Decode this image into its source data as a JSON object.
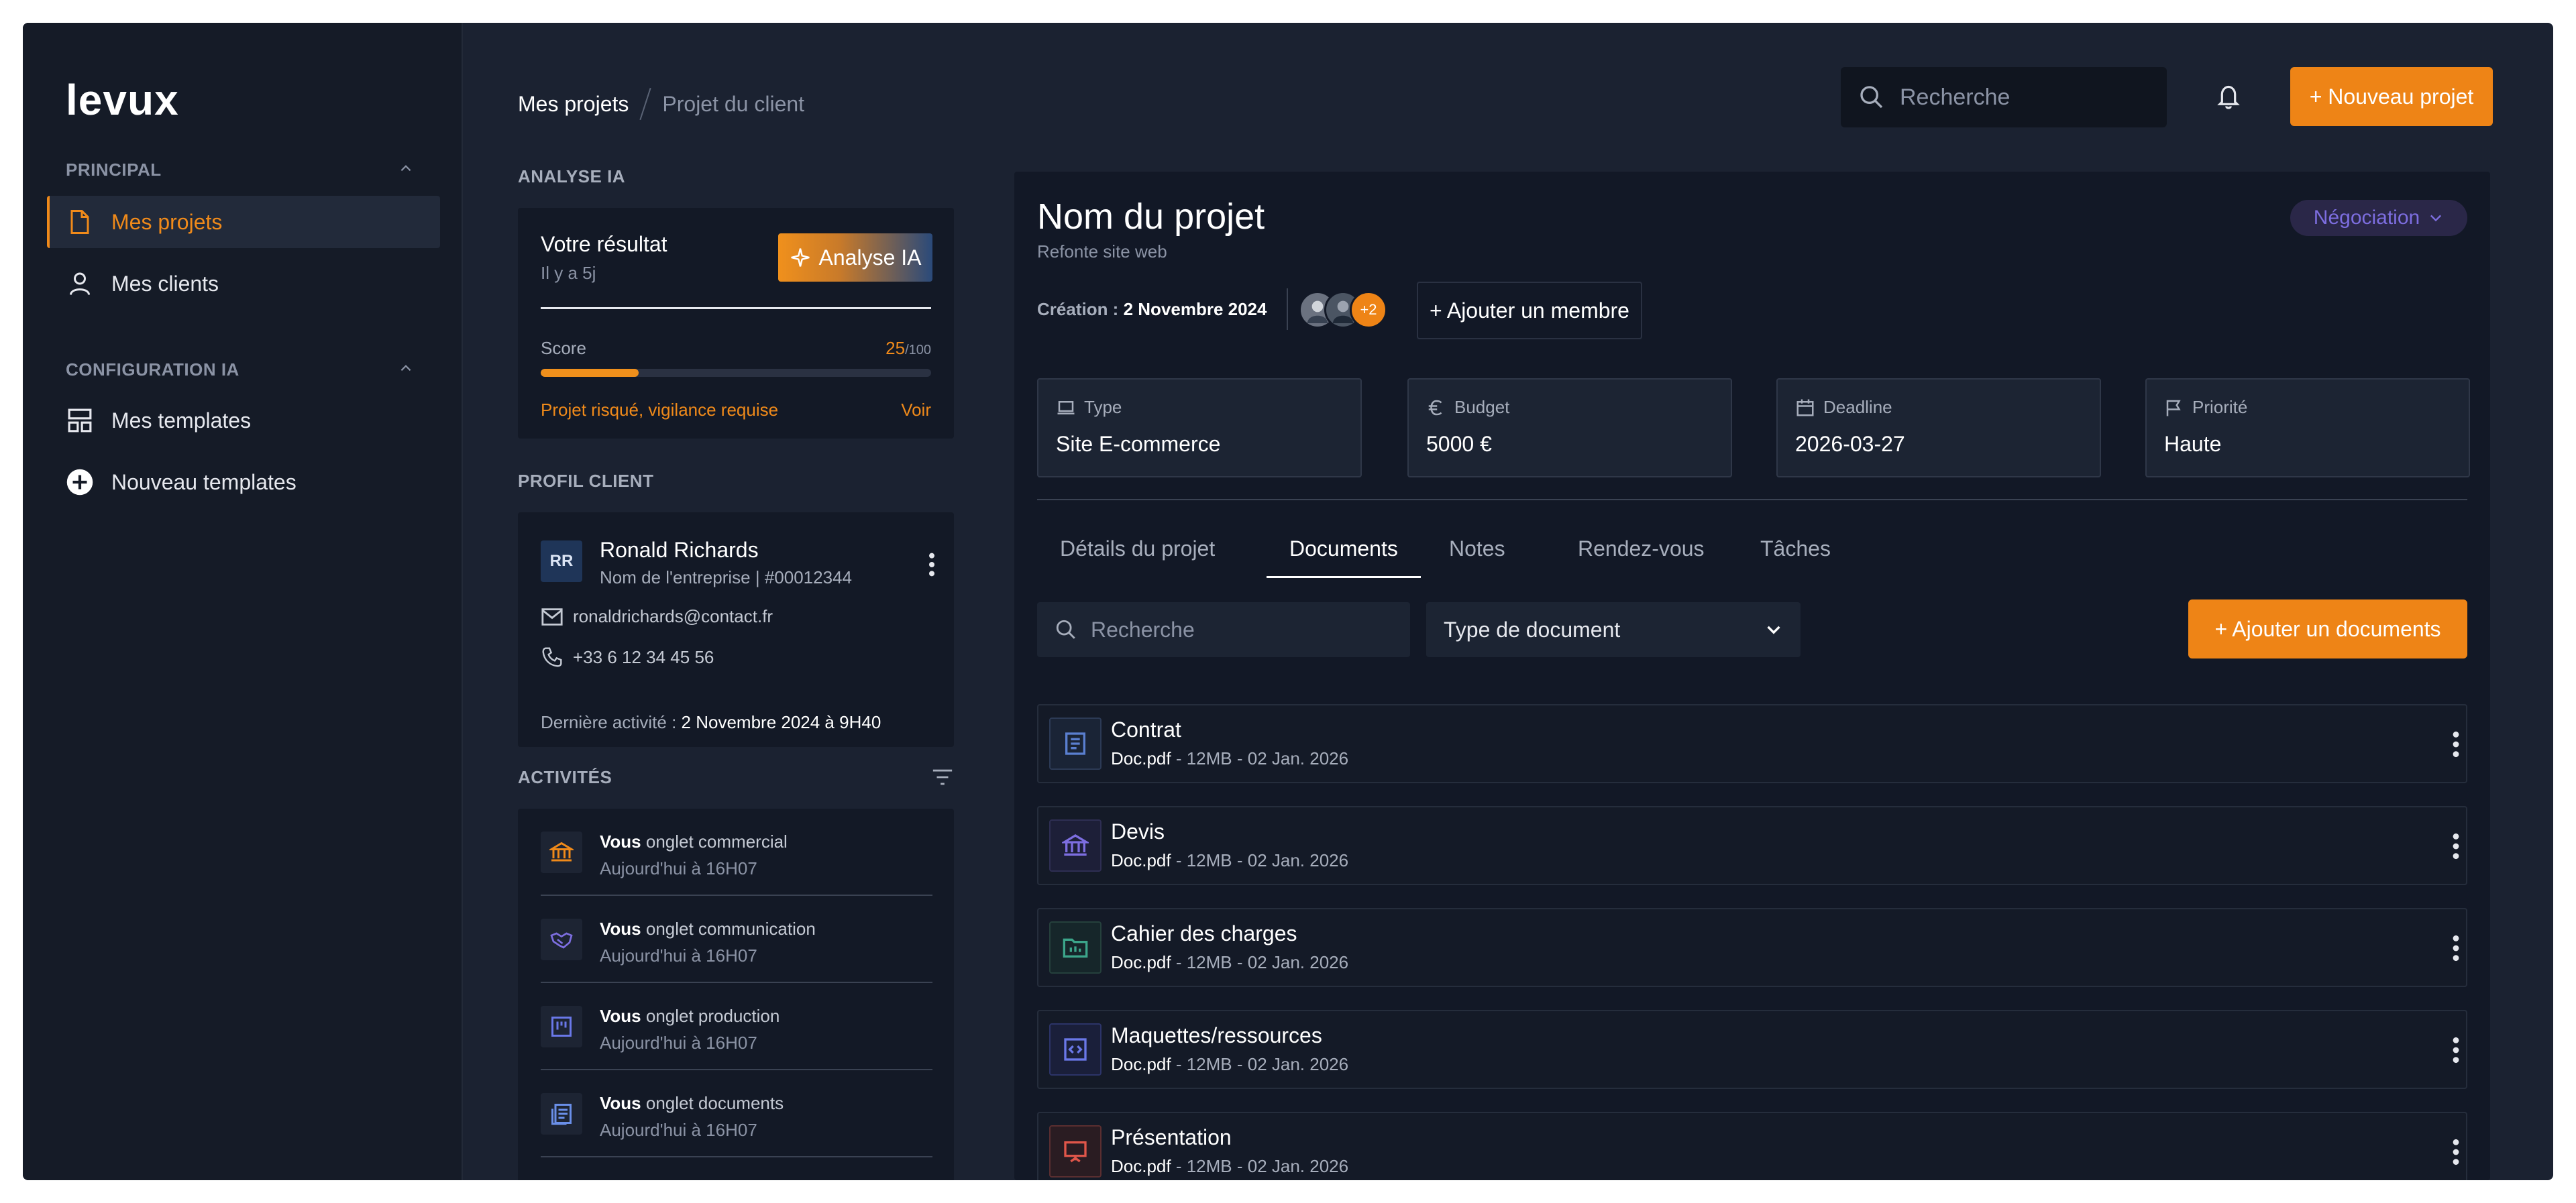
{
  "app": {
    "logo": "levux"
  },
  "sidebar": {
    "sections": [
      {
        "title": "PRINCIPAL",
        "items": [
          {
            "label": "Mes projets",
            "icon": "document-icon",
            "active": true
          },
          {
            "label": "Mes clients",
            "icon": "user-icon"
          }
        ]
      },
      {
        "title": "CONFIGURATION IA",
        "items": [
          {
            "label": "Mes templates",
            "icon": "layout-icon"
          },
          {
            "label": "Nouveau templates",
            "icon": "plus-circle-icon"
          }
        ]
      }
    ]
  },
  "header": {
    "breadcrumb": [
      "Mes projets",
      "Projet du client"
    ],
    "search_placeholder": "Recherche",
    "new_project_label": "+ Nouveau projet"
  },
  "ai_analysis": {
    "title": "ANALYSE IA",
    "result_label": "Votre résultat",
    "ago": "Il y a 5j",
    "button_label": "Analyse IA",
    "score_label": "Score",
    "score": "25",
    "score_max": "/100",
    "score_fraction": 0.25,
    "risk_text": "Projet risqué, vigilance requise",
    "see_label": "Voir"
  },
  "client": {
    "title": "PROFIL CLIENT",
    "initials": "RR",
    "name": "Ronald Richards",
    "company": "Nom de l'entreprise | #00012344",
    "email": "ronaldrichards@contact.fr",
    "phone": "+33 6 12 34 45 56",
    "last_activity_label": "Dernière activité : ",
    "last_activity_value": "2 Novembre 2024 à 9H40"
  },
  "activities": {
    "title": "ACTIVITÉS",
    "items": [
      {
        "who": "Vous",
        "text": " onglet commercial",
        "time": "Aujourd'hui à 16H07",
        "icon": "bank-icon",
        "color": "#f08a1a"
      },
      {
        "who": "Vous",
        "text": " onglet communication",
        "time": "Aujourd'hui à 16H07",
        "icon": "handshake-icon",
        "color": "#7d6ee0"
      },
      {
        "who": "Vous",
        "text": " onglet production",
        "time": "Aujourd'hui à 16H07",
        "icon": "kanban-icon",
        "color": "#6a78e8"
      },
      {
        "who": "Vous",
        "text": " onglet documents",
        "time": "Aujourd'hui à 16H07",
        "icon": "documents-icon",
        "color": "#6a8fe8"
      }
    ]
  },
  "project": {
    "title": "Nom du projet",
    "subtitle": "Refonte site web",
    "status": "Négociation",
    "created_label": "Création : ",
    "created_value": "2 Novembre 2024",
    "members_extra": "+2",
    "add_member_label": "+ Ajouter un membre",
    "meta": [
      {
        "label": "Type",
        "value": "Site E-commerce",
        "icon": "laptop-icon"
      },
      {
        "label": "Budget",
        "value": "5000 €",
        "icon": "euro-icon"
      },
      {
        "label": "Deadline",
        "value": "2026-03-27",
        "icon": "calendar-icon"
      },
      {
        "label": "Priorité",
        "value": "Haute",
        "icon": "flag-icon"
      }
    ],
    "tabs": [
      "Détails du projet",
      "Documents",
      "Notes",
      "Rendez-vous",
      "Tâches"
    ],
    "active_tab": "Documents",
    "doc_search_placeholder": "Recherche",
    "doc_type_label": "Type de document",
    "add_doc_label": "+ Ajouter un documents",
    "documents": [
      {
        "name": "Contrat",
        "file": "Doc.pdf",
        "info": " - 12MB - 02 Jan. 2026",
        "icon": "contract-icon",
        "color": "#5a7fd0",
        "bg": "#1a2436"
      },
      {
        "name": "Devis",
        "file": "Doc.pdf",
        "info": " - 12MB - 02 Jan. 2026",
        "icon": "bank-icon",
        "color": "#7d6ee0",
        "bg": "#1d1f38"
      },
      {
        "name": "Cahier des charges",
        "file": "Doc.pdf",
        "info": " - 12MB - 02 Jan. 2026",
        "icon": "folder-icon",
        "color": "#3ca58a",
        "bg": "#16262a"
      },
      {
        "name": "Maquettes/ressources",
        "file": "Doc.pdf",
        "info": " - 12MB - 02 Jan. 2026",
        "icon": "code-icon",
        "color": "#6a78e8",
        "bg": "#1a1f3a"
      },
      {
        "name": "Présentation",
        "file": "Doc.pdf",
        "info": " - 12MB - 02 Jan. 2026",
        "icon": "presentation-icon",
        "color": "#e0564a",
        "bg": "#2a1c22"
      }
    ]
  }
}
